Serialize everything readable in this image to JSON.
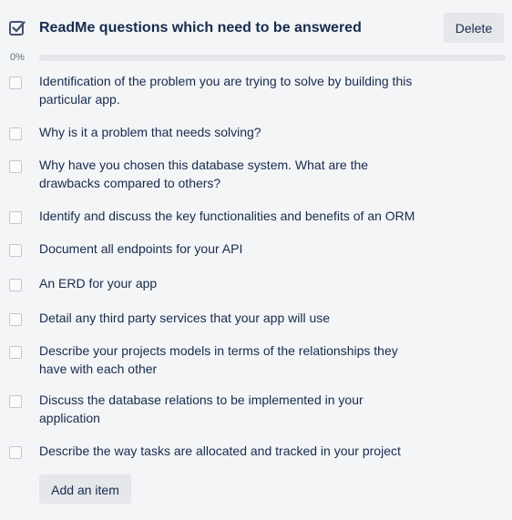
{
  "checklist": {
    "title": "ReadMe questions which need to be answered",
    "delete_label": "Delete",
    "progress_label": "0%",
    "progress_fraction": 0,
    "accent_color": "#5ba4cf",
    "items": [
      {
        "text": "Identification of the problem you are trying to solve by building this particular app.",
        "checked": false
      },
      {
        "text": "Why is it a problem that needs solving?",
        "checked": false
      },
      {
        "text": "Why have you chosen this database system. What are the drawbacks compared to others?",
        "checked": false
      },
      {
        "text": "Identify and discuss the key functionalities and benefits of an ORM",
        "checked": false
      },
      {
        "text": "Document all endpoints for your API",
        "checked": false
      },
      {
        "text": "An ERD for your app",
        "checked": false
      },
      {
        "text": "Detail any third party services that your app will use",
        "checked": false
      },
      {
        "text": "Describe your projects models in terms of the relationships they have with each other",
        "checked": false
      },
      {
        "text": "Discuss the database relations to be implemented in your application",
        "checked": false
      },
      {
        "text": "Describe the way tasks are allocated and tracked in your project",
        "checked": false
      }
    ],
    "add_item_label": "Add an item"
  }
}
